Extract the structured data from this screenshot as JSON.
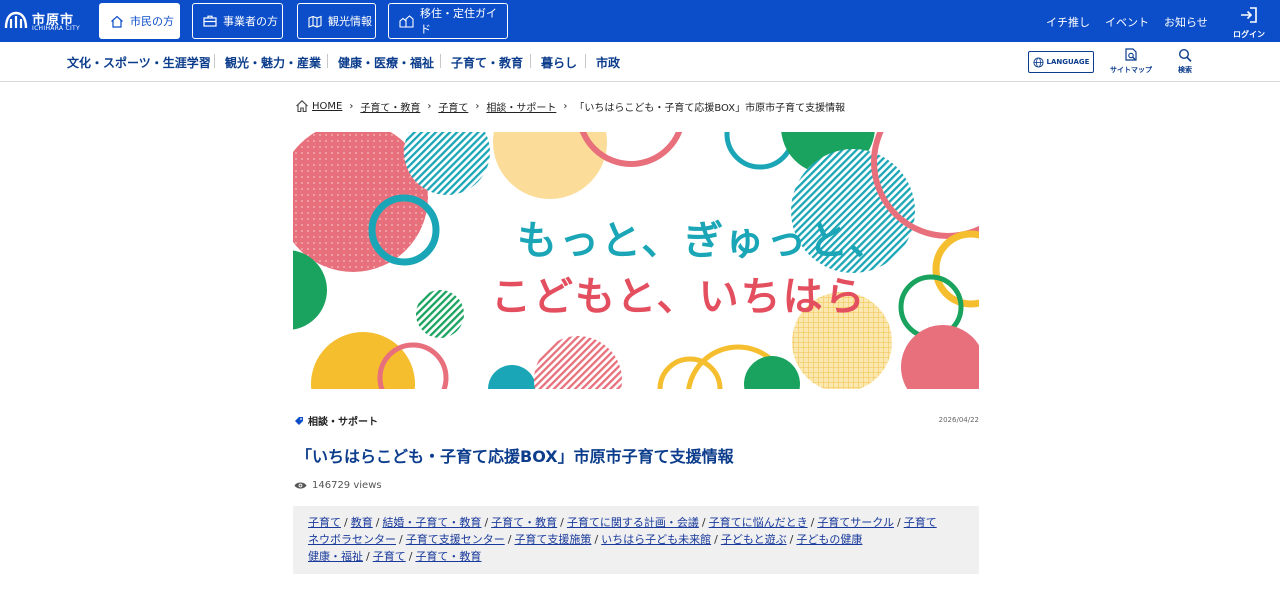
{
  "header": {
    "logo": {
      "name": "市原市",
      "sub": "ICHIHARA CITY"
    },
    "audience_tabs": [
      {
        "label": "市民の方",
        "icon": "home-icon",
        "active": true
      },
      {
        "label": "事業者の方",
        "icon": "briefcase-icon",
        "active": false
      },
      {
        "label": "観光情報",
        "icon": "map-icon",
        "active": false
      },
      {
        "label": "移住・定住ガイド",
        "icon": "town-icon",
        "active": false
      }
    ],
    "links": [
      "イチ推し",
      "イベント",
      "お知らせ"
    ],
    "login_label": "ログイン"
  },
  "catnav": {
    "items": [
      "文化・スポーツ・生涯学習",
      "観光・魅力・産業",
      "健康・医療・福祉",
      "子育て・教育",
      "暮らし",
      "市政"
    ],
    "language_label": "LANGUAGE",
    "sitemap_label": "サイトマップ",
    "search_label": "検索"
  },
  "breadcrumb": {
    "items": [
      "HOME",
      "子育て・教育",
      "子育て",
      "相談・サポート",
      "「いちはらこども・子育て応援BOX」市原市子育て支援情報"
    ]
  },
  "hero": {
    "line1": "もっと、ぎゅっと、",
    "line2": "こどもと、いちはら",
    "colors": {
      "pink": "#e8707c",
      "teal": "#1aa6b6",
      "yellow": "#f5be2e",
      "green": "#1aa35e",
      "sand": "#fbdc98",
      "red": "#e44f5f"
    }
  },
  "article": {
    "category": "相談・サポート",
    "date": "2026/04/22",
    "title": "「いちはらこども・子育て応援BOX」市原市子育て支援情報",
    "views": "146729 views"
  },
  "tags": {
    "line1": [
      "子育て",
      "教育",
      "結婚・子育て・教育",
      "子育て・教育",
      "子育てに関する計画・会議",
      "子育てに悩んだとき",
      "子育てサークル",
      "子育て"
    ],
    "line2": [
      "ネウボラセンター",
      "子育て支援センター",
      "子育て支援施策",
      "いちはら子ども未来館",
      "子どもと遊ぶ",
      "子どもの健康"
    ],
    "line3": [
      "健康・福祉",
      "子育て",
      "子育て・教育"
    ],
    "separator": "/"
  }
}
